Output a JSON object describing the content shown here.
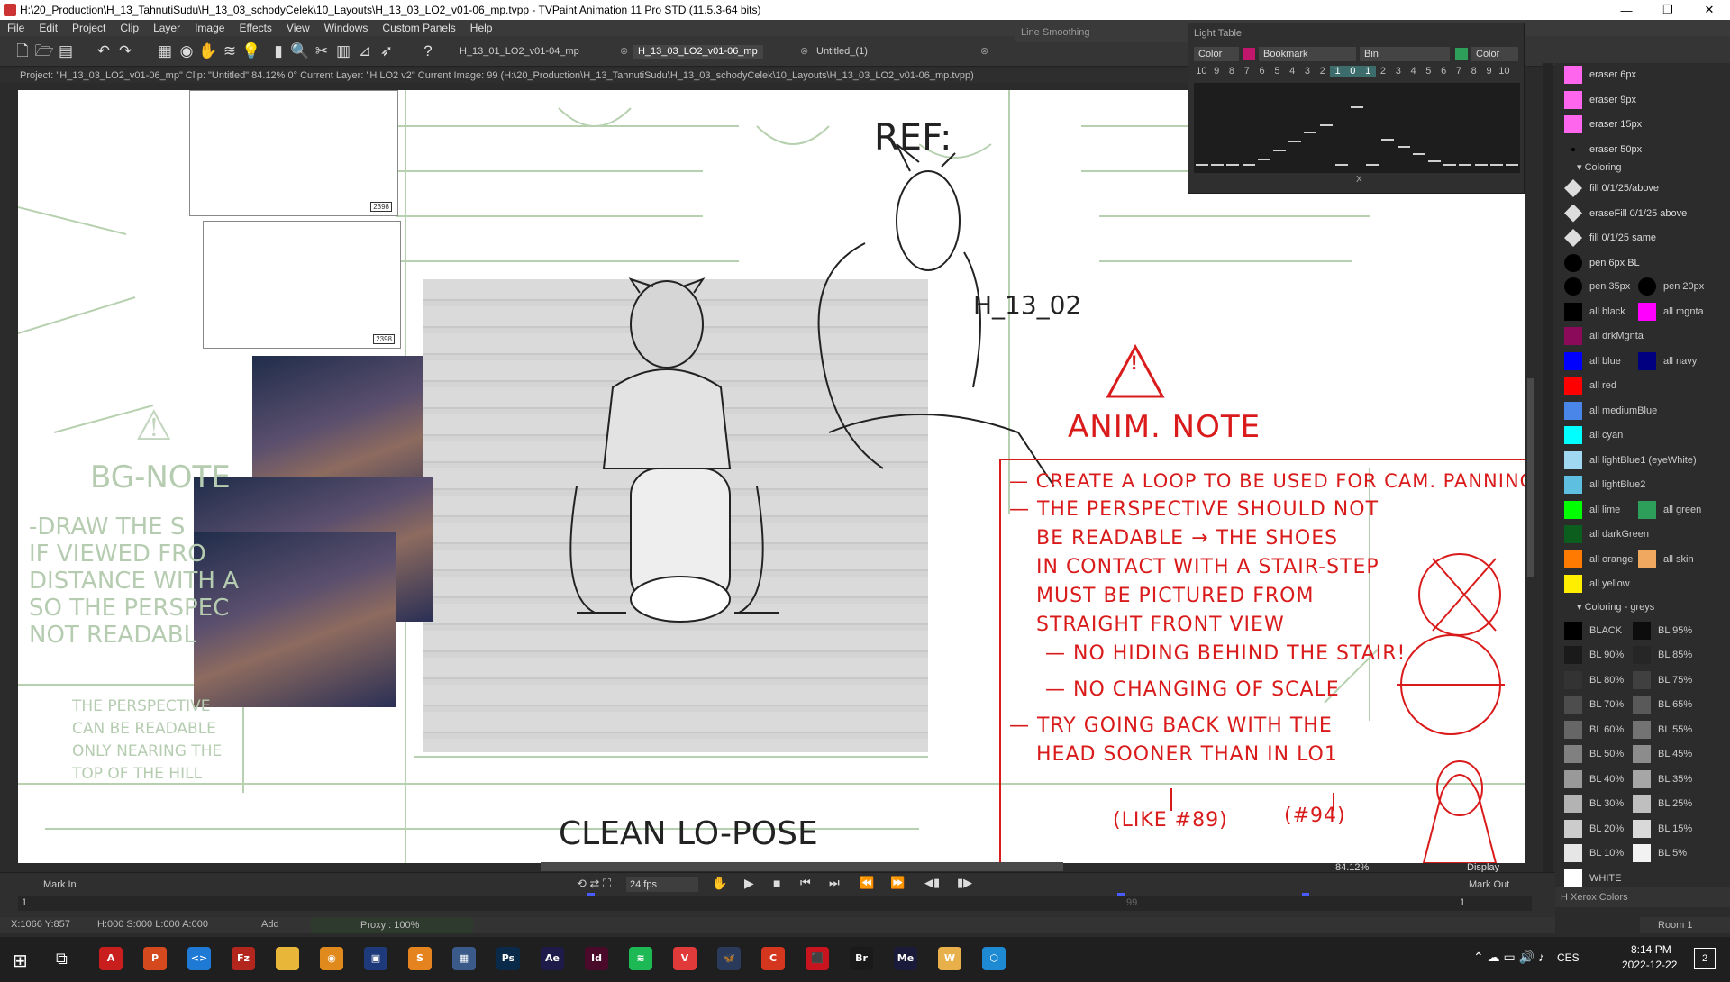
{
  "window": {
    "title": "H:\\20_Production\\H_13_TahnutiSudu\\H_13_03_schodyCelek\\10_Layouts\\H_13_03_LO2_v01-06_mp.tvpp - TVPaint Animation 11 Pro STD (11.5.3-64 bits)"
  },
  "menu": [
    "File",
    "Edit",
    "Project",
    "Clip",
    "Layer",
    "Image",
    "Effects",
    "View",
    "Windows",
    "Custom Panels",
    "Help"
  ],
  "doc_tabs": [
    "H_13_01_LO2_v01-04_mp",
    "H_13_03_LO2_v01-06_mp",
    "Untitled_(1)"
  ],
  "info_line": "Project: \"H_13_03_LO2_v01-06_mp\"  Clip: \"Untitled\"  84.12%  0°  Current Layer: \"H LO2 v2\"  Current Image: 99 (H:\\20_Production\\H_13_TahnutiSudu\\H_13_03_schodyCelek\\10_Layouts\\H_13_03_LO2_v01-06_mp.tvpp)",
  "line_smoothing": {
    "label": "Line Smoothing"
  },
  "light_table": {
    "title": "Light Table",
    "selects": [
      "Color",
      "Bookmark",
      "Bin",
      "Color"
    ],
    "numbers": [
      "10",
      "9",
      "8",
      "7",
      "6",
      "5",
      "4",
      "3",
      "2",
      "1",
      "0",
      "1",
      "2",
      "3",
      "4",
      "5",
      "6",
      "7",
      "8",
      "9",
      "10"
    ],
    "highlighted": [
      "1",
      "0",
      "1"
    ],
    "x_label": "X",
    "levels": [
      0,
      0,
      0,
      0,
      0.08,
      0.2,
      0.32,
      0.45,
      0.55,
      0,
      0.8,
      0,
      0.35,
      0.25,
      0.15,
      0.05,
      0,
      0,
      0,
      0,
      0
    ]
  },
  "canvas": {
    "ref_label": "REF:",
    "shot_label": "H_13_02",
    "clean_label": "CLEAN LO-POSE",
    "thumb_labels": [
      "2398",
      "2398"
    ],
    "bg_note_title": "BG-NOTE",
    "bg_note_lines": [
      "-DRAW THE S",
      "IF VIEWED FRO",
      "DISTANCE WITH A",
      "SO THE PERSPEC",
      "NOT READABL"
    ],
    "bg_small_lines": [
      "THE PERSPECTIVE",
      "CAN BE READABLE",
      "ONLY NEARING THE",
      "TOP OF THE HILL"
    ],
    "anim_note_title": "ANIM. NOTE",
    "anim_note_lines": [
      "— CREATE A LOOP TO BE USED FOR CAM. PANNING",
      "— THE PERSPECTIVE SHOULD NOT",
      "BE READABLE → THE SHOES",
      "IN CONTACT WITH A STAIR-STEP",
      "MUST BE PICTURED FROM",
      "STRAIGHT FRONT VIEW",
      "— NO HIDING BEHIND THE STAIR!",
      "— NO CHANGING OF SCALE",
      "— TRY GOING BACK WITH THE",
      "HEAD SOONER THAN IN LO1"
    ],
    "refs": [
      "(LIKE #89)",
      "(#94)"
    ]
  },
  "zoom": "84.12%",
  "display_label": "Display",
  "timeline": {
    "mark_in": "Mark In",
    "mark_out": "Mark Out",
    "fps": "24 fps",
    "start_frame": "1",
    "end_frame": "1",
    "current_frame_marker": "99"
  },
  "status": {
    "coords": "X:1066  Y:857",
    "timecode": "H:000 S:000 L:000 A:000",
    "mode": "Add",
    "proxy": "Proxy : 100%"
  },
  "brushes": [
    {
      "label": "eraser 6px",
      "color": "#ff66ee"
    },
    {
      "label": "eraser 9px",
      "color": "#ff66ee"
    },
    {
      "label": "eraser 15px",
      "color": "#ff66ee"
    },
    {
      "label": "eraser 50px",
      "color": "dot"
    }
  ],
  "coloring_header": "Coloring",
  "coloring": [
    {
      "label": "fill 0/1/25/above",
      "icon": "bucket"
    },
    {
      "label": "eraseFill 0/1/25 above",
      "icon": "bucket"
    },
    {
      "label": "fill 0/1/25 same",
      "icon": "bucket"
    },
    {
      "label": "pen 6px BL",
      "color": "#000000",
      "round": true
    }
  ],
  "coloring_pairs": [
    {
      "left": {
        "label": "pen 35px",
        "color": "#000000",
        "round": true
      },
      "right": {
        "label": "pen 20px",
        "color": "#000000",
        "round": true
      }
    },
    {
      "left": {
        "label": "all black",
        "color": "#000000"
      },
      "right": {
        "label": "all mgnta",
        "color": "#ff00ff"
      }
    },
    {
      "left": {
        "label": "all drkMgnta",
        "color": "#8b0a5a"
      },
      "right": null
    },
    {
      "left": {
        "label": "all blue",
        "color": "#0000ff"
      },
      "right": {
        "label": "all navy",
        "color": "#000080"
      }
    },
    {
      "left": {
        "label": "all red",
        "color": "#ff0000"
      },
      "right": null
    },
    {
      "left": {
        "label": "all mediumBlue",
        "color": "#4a86e8"
      },
      "right": null
    },
    {
      "left": {
        "label": "all cyan",
        "color": "#00ffff"
      },
      "right": null
    },
    {
      "left": {
        "label": "all lightBlue1 (eyeWhite)",
        "color": "#9fd8f0"
      },
      "right": null
    },
    {
      "left": {
        "label": "all lightBlue2",
        "color": "#5fbfe0"
      },
      "right": null
    },
    {
      "left": {
        "label": "all lime",
        "color": "#00ff00"
      },
      "right": {
        "label": "all green",
        "color": "#2e9e5b"
      }
    },
    {
      "left": {
        "label": "all darkGreen",
        "color": "#0b5e1e"
      },
      "right": null
    },
    {
      "left": {
        "label": "all orange",
        "color": "#ff7a00"
      },
      "right": {
        "label": "all skin",
        "color": "#f0a860"
      }
    },
    {
      "left": {
        "label": "all yellow",
        "color": "#ffee00"
      },
      "right": null
    }
  ],
  "greys_header": "Coloring - greys",
  "greys": [
    {
      "left": {
        "label": "BLACK",
        "color": "#000000"
      },
      "right": {
        "label": "BL 95%",
        "color": "#0d0d0d"
      }
    },
    {
      "left": {
        "label": "BL 90%",
        "color": "#1a1a1a"
      },
      "right": {
        "label": "BL 85%",
        "color": "#262626"
      }
    },
    {
      "left": {
        "label": "BL 80%",
        "color": "#333333"
      },
      "right": {
        "label": "BL 75%",
        "color": "#404040"
      }
    },
    {
      "left": {
        "label": "BL 70%",
        "color": "#4d4d4d"
      },
      "right": {
        "label": "BL 65%",
        "color": "#595959"
      }
    },
    {
      "left": {
        "label": "BL 60%",
        "color": "#666666"
      },
      "right": {
        "label": "BL 55%",
        "color": "#737373"
      }
    },
    {
      "left": {
        "label": "BL 50%",
        "color": "#808080"
      },
      "right": {
        "label": "BL 45%",
        "color": "#8c8c8c"
      }
    },
    {
      "left": {
        "label": "BL 40%",
        "color": "#999999"
      },
      "right": {
        "label": "BL 35%",
        "color": "#a6a6a6"
      }
    },
    {
      "left": {
        "label": "BL 30%",
        "color": "#b3b3b3"
      },
      "right": {
        "label": "BL 25%",
        "color": "#bfbfbf"
      }
    },
    {
      "left": {
        "label": "BL 20%",
        "color": "#cccccc"
      },
      "right": {
        "label": "BL 15%",
        "color": "#d9d9d9"
      }
    },
    {
      "left": {
        "label": "BL 10%",
        "color": "#e6e6e6"
      },
      "right": {
        "label": "BL 5%",
        "color": "#f2f2f2"
      }
    },
    {
      "left": {
        "label": "WHITE",
        "color": "#ffffff"
      },
      "right": null
    }
  ],
  "panel_footer": "H Xerox Colors",
  "room_label": "Room 1",
  "taskbar": {
    "apps": [
      {
        "name": "acrobat-app",
        "text": "A",
        "color": "#c81e1e"
      },
      {
        "name": "paint-app",
        "text": "P",
        "color": "#d44a1e"
      },
      {
        "name": "vscode-app",
        "text": "<>",
        "color": "#1e7ad4"
      },
      {
        "name": "filezilla-app",
        "text": "Fz",
        "color": "#b3261e"
      },
      {
        "name": "explorer-app",
        "text": "",
        "color": "#e8b73a"
      },
      {
        "name": "eye-app",
        "text": "◉",
        "color": "#e08a1e"
      },
      {
        "name": "save-app",
        "text": "▣",
        "color": "#1e3a7a"
      },
      {
        "name": "sublime-app",
        "text": "S",
        "color": "#e5841e"
      },
      {
        "name": "calculator-app",
        "text": "▦",
        "color": "#3a5a8a"
      },
      {
        "name": "photoshop-app",
        "text": "Ps",
        "color": "#0a2a4a"
      },
      {
        "name": "aftereffects-app",
        "text": "Ae",
        "color": "#1e1a4a"
      },
      {
        "name": "indesign-app",
        "text": "Id",
        "color": "#4a0a2a"
      },
      {
        "name": "spotify-app",
        "text": "≋",
        "color": "#1db954"
      },
      {
        "name": "vivaldi-app",
        "text": "V",
        "color": "#e03a3a"
      },
      {
        "name": "butterfly-app",
        "text": "🦋",
        "color": "#2a3a5a"
      },
      {
        "name": "creative-cloud-app",
        "text": "C",
        "color": "#d4361e"
      },
      {
        "name": "pdf-app",
        "text": "⬛",
        "color": "#c8141e"
      },
      {
        "name": "bridge-app",
        "text": "Br",
        "color": "#1a1a1a"
      },
      {
        "name": "mediaencoder-app",
        "text": "Me",
        "color": "#1a1a3a"
      },
      {
        "name": "wacom-app",
        "text": "W",
        "color": "#e8b04a"
      },
      {
        "name": "box-app",
        "text": "⬡",
        "color": "#1e8ad4"
      }
    ],
    "lang": "CES",
    "time": "8:14 PM",
    "date": "2022-12-22",
    "notif": "2"
  }
}
